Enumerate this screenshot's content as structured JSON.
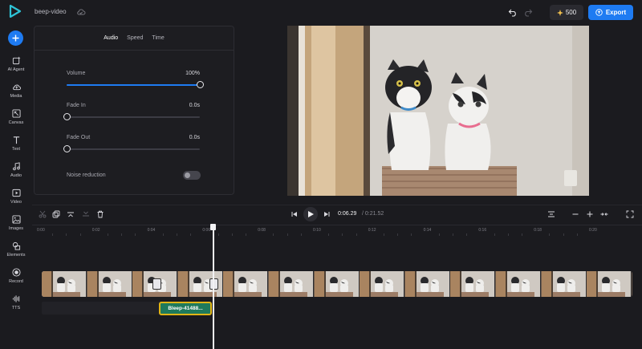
{
  "header": {
    "project_name": "beep-video",
    "credits": "500",
    "export_label": "Export"
  },
  "sidebar": {
    "items": [
      {
        "label": "AI Agent",
        "icon": "ai-agent-icon"
      },
      {
        "label": "Media",
        "icon": "media-upload-icon"
      },
      {
        "label": "Canvas",
        "icon": "canvas-icon"
      },
      {
        "label": "Text",
        "icon": "text-icon"
      },
      {
        "label": "Audio",
        "icon": "music-note-icon"
      },
      {
        "label": "Video",
        "icon": "video-icon"
      },
      {
        "label": "Images",
        "icon": "image-icon"
      },
      {
        "label": "Elements",
        "icon": "elements-icon"
      },
      {
        "label": "Record",
        "icon": "record-icon"
      },
      {
        "label": "TTS",
        "icon": "waveform-icon"
      }
    ]
  },
  "panel": {
    "tabs": [
      "Audio",
      "Speed",
      "Time"
    ],
    "active_tab": "Audio",
    "volume": {
      "label": "Volume",
      "value": "100%",
      "level": 1.0
    },
    "fade_in": {
      "label": "Fade In",
      "value": "0.0s",
      "level": 0.0
    },
    "fade_out": {
      "label": "Fade Out",
      "value": "0.0s",
      "level": 0.0
    },
    "noise_reduction": {
      "label": "Noise reduction",
      "enabled": false
    }
  },
  "player": {
    "current_time": "0:06.29",
    "total_time": "/ 0:21.52"
  },
  "timeline": {
    "ruler_ticks": [
      "0:00",
      "0:02",
      "0:04",
      "0:06",
      "0:08",
      "0:10",
      "0:12",
      "0:14",
      "0:16",
      "0:18",
      "0:20"
    ],
    "audio_clip_label": "Bleep-41488..."
  },
  "colors": {
    "accent": "#1e7bf2",
    "background": "#1b1b1f",
    "audio_clip": "#1f7a5c",
    "audio_clip_border": "#e1b516"
  }
}
